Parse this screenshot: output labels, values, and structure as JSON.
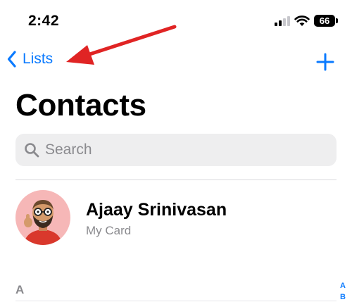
{
  "status_bar": {
    "time": "2:42",
    "battery": "66",
    "signal_icon": "cellular-signal-icon",
    "wifi_icon": "wifi-icon"
  },
  "nav": {
    "back_label": "Lists",
    "back_icon": "chevron-left-icon",
    "add_icon": "plus-icon"
  },
  "title": "Contacts",
  "search": {
    "placeholder": "Search",
    "icon": "magnifying-glass-icon"
  },
  "my_card": {
    "name": "Ajaay Srinivasan",
    "subtitle": "My Card"
  },
  "sections": [
    {
      "header": "A"
    }
  ],
  "index": [
    "A",
    "B"
  ],
  "colors": {
    "accent": "#0a7aff",
    "annotation": "#e02424",
    "secondary_text": "#8a8a8e",
    "search_bg": "#eeeeef"
  }
}
